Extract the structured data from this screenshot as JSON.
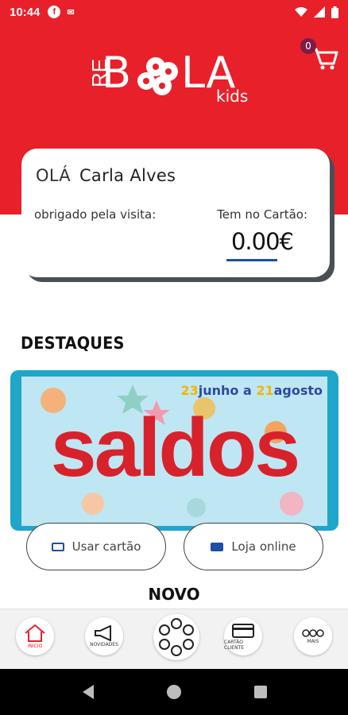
{
  "status": {
    "time": "10:44"
  },
  "header": {
    "logo": {
      "part1": "RE",
      "part2": "B",
      "part3": "LA",
      "part4": "kids"
    },
    "cart_count": "0"
  },
  "account": {
    "greeting": "OLÁ",
    "name": "Carla Alves",
    "thanks": "obrigado pela visita:",
    "card_label": "Tem no Cartão:",
    "balance": "0.00€"
  },
  "highlights": {
    "title": "DESTAQUES",
    "banner": {
      "date_d1": "23",
      "date_t1": "junho a ",
      "date_d2": "21",
      "date_t2": "agosto",
      "sale_text": "saldos"
    }
  },
  "actions": {
    "use_card": "Usar cartão",
    "online_store": "Loja online"
  },
  "new_section": {
    "title": "NOVO"
  },
  "bottom_nav": {
    "home": "INÍCIO",
    "news": "NOVIDADES",
    "card": "CARTÃO CLIENTE",
    "more": "MAIS"
  },
  "colors": {
    "brand": "#e8202a",
    "accent": "#1b4fa8"
  }
}
